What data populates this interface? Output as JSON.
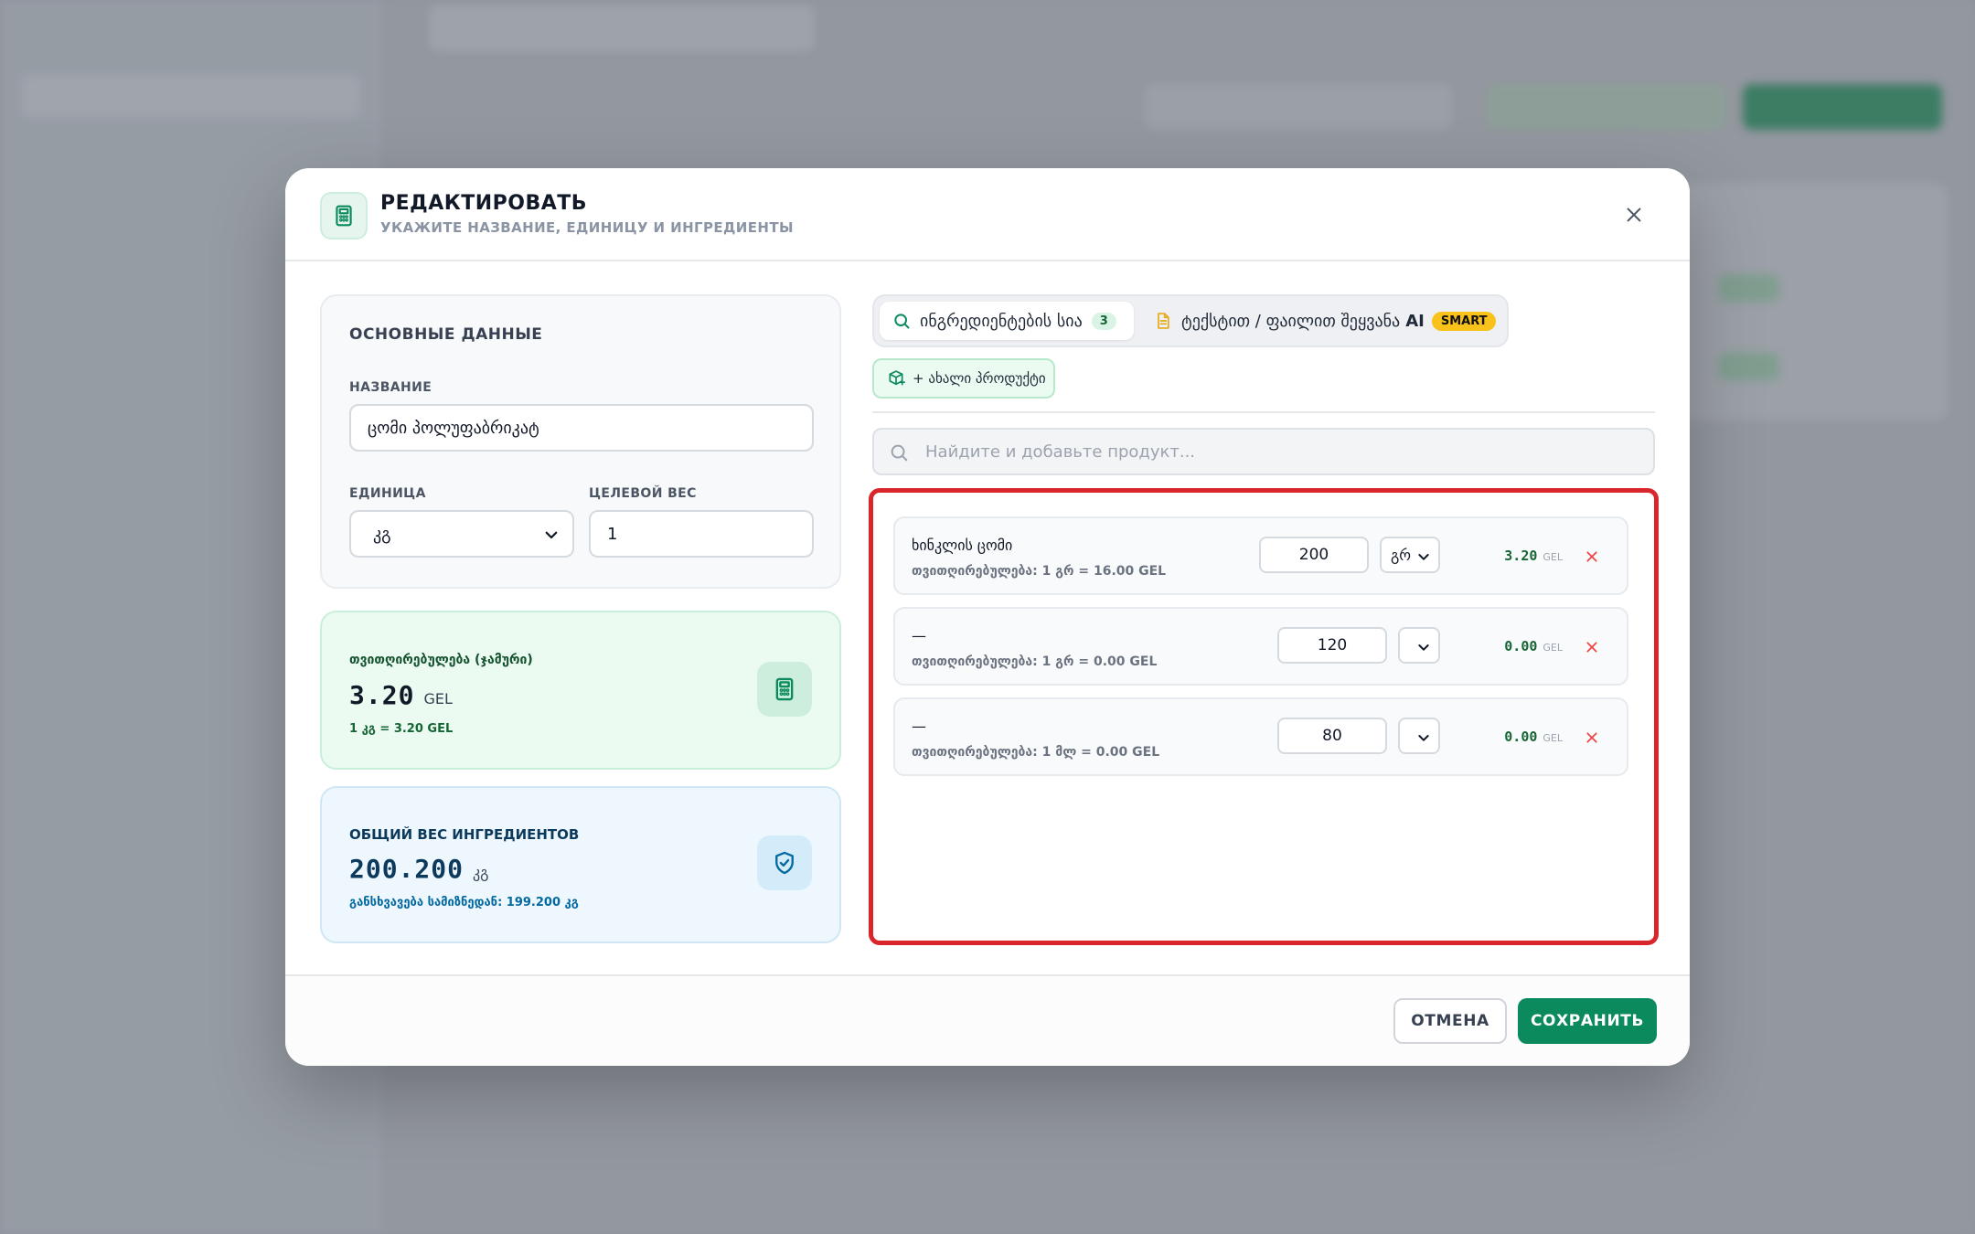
{
  "modal": {
    "title": "РЕДАКТИРОВАТЬ",
    "subtitle": "УКАЖИТЕ НАЗВАНИЕ, ЕДИНИЦУ И ИНГРЕДИЕНТЫ",
    "icons": {
      "header": "calculator-icon",
      "close": "close-icon"
    }
  },
  "basic": {
    "section_title": "ОСНОВНЫЕ ДАННЫЕ",
    "name_label": "НАЗВАНИЕ",
    "name_value": "ცომი პოლუფაბრიკატ",
    "unit_label": "ЕДИНИЦА",
    "unit_value": "კგ",
    "target_label": "ЦЕЛЕВОЙ ВЕС",
    "target_value": "1"
  },
  "cost_card": {
    "label": "თვითღირებულება (ჯამური)",
    "value": "3.20",
    "unit": "GEL",
    "note": "1 კგ = 3.20 GEL",
    "icon": "calculator-icon"
  },
  "weight_card": {
    "label": "ОБЩИЙ ВЕС ИНГРЕДИЕНТОВ",
    "value": "200.200",
    "unit": "კგ",
    "note": "განსხვავება სამიზნედან: 199.200 კგ",
    "icon": "shield-check-icon"
  },
  "tabs": {
    "ingredients_label": "ინგრედიენტების სია",
    "ingredients_count": "3",
    "text_label": "ტექსტით / ფაილით შეყვანა",
    "ai_label": "AI",
    "smart_badge": "SMART"
  },
  "new_product_label": "+ ახალი პროდუქტი",
  "search": {
    "placeholder": "Найдите и добавьте продукт..."
  },
  "ingredients": [
    {
      "name": "ხინკლის ცომი",
      "cost": "თვითღირებულება: 1 გრ = 16.00 GEL",
      "qty": "200",
      "unit": "გრ",
      "total": "3.20",
      "currency": "GEL"
    },
    {
      "name": "—",
      "cost": "თვითღირებულება: 1 გრ = 0.00 GEL",
      "qty": "120",
      "unit": "",
      "total": "0.00",
      "currency": "GEL"
    },
    {
      "name": "—",
      "cost": "თვითღირებულება: 1 მლ = 0.00 GEL",
      "qty": "80",
      "unit": "",
      "total": "0.00",
      "currency": "GEL"
    }
  ],
  "footer": {
    "cancel_label": "ОТМЕНА",
    "save_label": "СОХРАНИТЬ"
  },
  "colors": {
    "accent": "#0b8a5e",
    "highlight_border": "#d9262b",
    "smart_badge": "#f8c21a"
  }
}
